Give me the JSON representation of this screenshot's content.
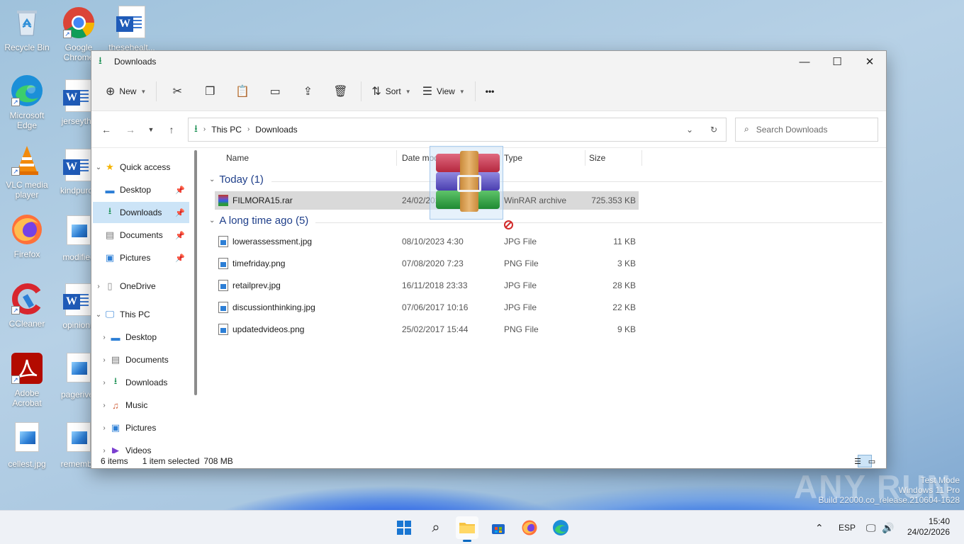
{
  "desktop": {
    "icons": [
      {
        "label": "Recycle Bin"
      },
      {
        "label": "Google Chrome"
      },
      {
        "label": "thesehealt..."
      },
      {
        "label": "Microsoft Edge"
      },
      {
        "label": "jerseythe"
      },
      {
        "label": "VLC media player"
      },
      {
        "label": "kindpurch"
      },
      {
        "label": "Firefox"
      },
      {
        "label": "modified"
      },
      {
        "label": "CCleaner"
      },
      {
        "label": "opinionu"
      },
      {
        "label": "Adobe Acrobat"
      },
      {
        "label": "pageriver"
      },
      {
        "label": "cellest.jpg"
      },
      {
        "label": "remembe"
      }
    ]
  },
  "window": {
    "title": "Downloads",
    "controls": {
      "minimize": "—",
      "maximize": "☐",
      "close": "✕"
    }
  },
  "toolbar": {
    "new_label": "New",
    "sort_label": "Sort",
    "view_label": "View",
    "more_label": "•••"
  },
  "address": {
    "crumbs": [
      "This PC",
      "Downloads"
    ],
    "search_placeholder": "Search Downloads"
  },
  "sidebar": {
    "quick_access": "Quick access",
    "items": [
      {
        "label": "Desktop"
      },
      {
        "label": "Downloads"
      },
      {
        "label": "Documents"
      },
      {
        "label": "Pictures"
      },
      {
        "label": "OneDrive"
      },
      {
        "label": "This PC"
      },
      {
        "label": "Desktop"
      },
      {
        "label": "Documents"
      },
      {
        "label": "Downloads"
      },
      {
        "label": "Music"
      },
      {
        "label": "Pictures"
      },
      {
        "label": "Videos"
      }
    ]
  },
  "columns": {
    "name": "Name",
    "date": "Date modified",
    "type": "Type",
    "size": "Size"
  },
  "groups": [
    {
      "header": "Today (1)",
      "files": [
        {
          "name": "FILMORA15.rar",
          "date": "24/02/2026 15:39",
          "type": "WinRAR archive",
          "size": "725.353 KB",
          "selected": true
        }
      ]
    },
    {
      "header": "A long time ago (5)",
      "files": [
        {
          "name": "lowerassessment.jpg",
          "date": "08/10/2023 4:30",
          "type": "JPG File",
          "size": "11 KB"
        },
        {
          "name": "timefriday.png",
          "date": "07/08/2020 7:23",
          "type": "PNG File",
          "size": "3 KB"
        },
        {
          "name": "retailprev.jpg",
          "date": "16/11/2018 23:33",
          "type": "JPG File",
          "size": "28 KB"
        },
        {
          "name": "discussionthinking.jpg",
          "date": "07/06/2017 10:16",
          "type": "JPG File",
          "size": "22 KB"
        },
        {
          "name": "updatedvideos.png",
          "date": "25/02/2017 15:44",
          "type": "PNG File",
          "size": "9 KB"
        }
      ]
    }
  ],
  "status": {
    "items": "6 items",
    "selection": "1 item selected",
    "size": "708 MB"
  },
  "taskbar": {
    "lang": "ESP",
    "time": "15:40",
    "date": "24/02/2026"
  },
  "watermark": {
    "logo": "ANY RUN",
    "line1": "Test Mode",
    "line2": "Windows 11 Pro",
    "line3": "Build 22000.co_release.210604-1628"
  },
  "colors": {
    "accent": "#0067c0",
    "selection": "#cce4f7",
    "row_selected": "#d9d9d9"
  }
}
